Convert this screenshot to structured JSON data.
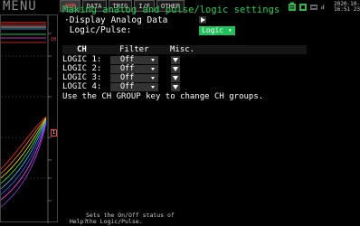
{
  "menu_label": "MENU",
  "wave_panel": {
    "ch_tag_top": "CH",
    "ch_tag_mid": "1"
  },
  "tabs": [
    {
      "label": "AMP",
      "active": true
    },
    {
      "label": "DATA",
      "active": false
    },
    {
      "label": "TRIG",
      "active": false
    },
    {
      "label": "I/F",
      "active": false
    },
    {
      "label": "OTHER",
      "active": false
    }
  ],
  "status": {
    "date": "2020-10-",
    "time": "16:51 23",
    "icons": [
      "battery-icon",
      "memory-icon",
      "usb-icon",
      "signal-icon"
    ]
  },
  "settings": {
    "title": "Making analog and pulse/logic settings",
    "display_analog_label": "·Display Analog Data",
    "logic_pulse_label": " Logic/Pulse:",
    "logic_pulse_value": "Logic ▾"
  },
  "table": {
    "headers": {
      "ch": "CH",
      "filter": "Filter",
      "misc": "Misc."
    },
    "rows": [
      {
        "label": "LOGIC 1:",
        "filter": "Off"
      },
      {
        "label": "LOGIC 2:",
        "filter": "Off"
      },
      {
        "label": "LOGIC 3:",
        "filter": "Off"
      },
      {
        "label": "LOGIC 4:",
        "filter": "Off"
      }
    ]
  },
  "hint": "Use the CH GROUP key to change CH groups.",
  "help": {
    "prefix": "Help?",
    "text": "Sets the On/Off status of\nthe Logic/Pulse."
  },
  "colors": {
    "title_green": "#22cc55",
    "select_green": "#1ec15a",
    "active_tab_red": "#ff5050"
  }
}
